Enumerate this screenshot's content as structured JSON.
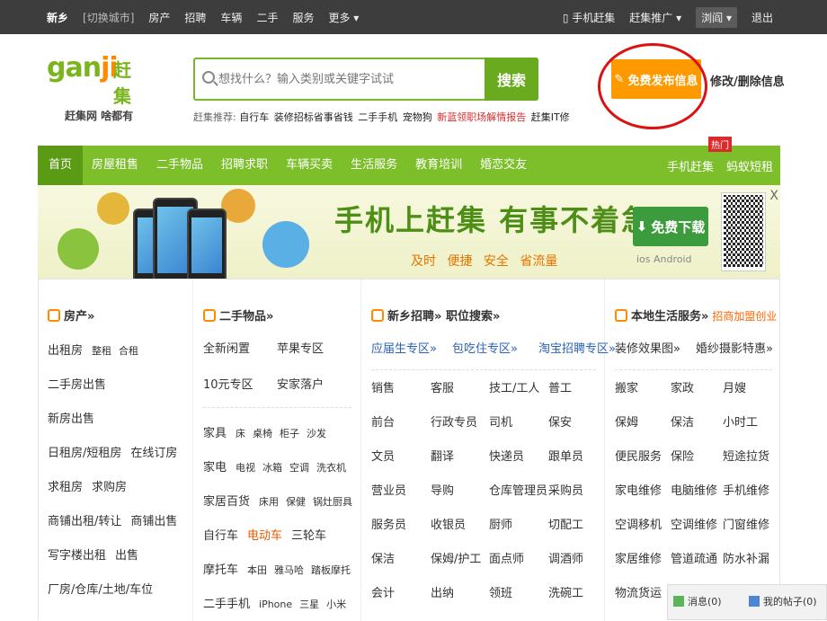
{
  "topbar": {
    "city": "新乡",
    "switch_city": "[切换城市]",
    "links": [
      "房产",
      "招聘",
      "车辆",
      "二手",
      "服务",
      "更多 ▾"
    ],
    "mobile": "手机赶集",
    "promote": "赶集推广 ▾",
    "user": "浏阎 ▾",
    "logout": "退出"
  },
  "logo": {
    "mark": "gan",
    "mark_accent": "ji",
    "cn": "赶集",
    "slogan": "赶集网 啥都有"
  },
  "search": {
    "placeholder": "想找什么？输入类别或关键字试试",
    "button": "搜索"
  },
  "hot": {
    "label": "赶集推荐:",
    "items": [
      "自行车",
      "装修招标省事省钱",
      "二手手机",
      "宠物狗",
      "新蓝领职场解情报告",
      "赶集IT修"
    ]
  },
  "post": {
    "button": "免费发布信息",
    "edit": "修改/删除信息"
  },
  "nav": {
    "items": [
      "首页",
      "房屋租售",
      "二手物品",
      "招聘求职",
      "车辆买卖",
      "生活服务",
      "教育培训",
      "婚恋交友"
    ],
    "right": [
      "手机赶集",
      "蚂蚁短租"
    ],
    "badge": "热门"
  },
  "banner": {
    "title": "手机上赶集  有事不着急",
    "sub": "及时 便捷 安全 省流量",
    "download": "免费下载",
    "os": "ios  Android",
    "close": "X"
  },
  "house": {
    "title": "房产»",
    "rows": [
      [
        "出租房",
        "整租",
        "合租"
      ],
      [
        "二手房出售"
      ],
      [
        "新房出售"
      ],
      [
        "日租房/短租房",
        "在线订房"
      ],
      [
        "求租房",
        "求购房"
      ],
      [
        "商铺出租/转让",
        "商铺出售"
      ],
      [
        "写字楼出租",
        "出售"
      ],
      [
        "厂房/仓库/土地/车位"
      ]
    ]
  },
  "used": {
    "title": "二手物品»",
    "top": [
      [
        "全新闲置",
        "苹果专区"
      ],
      [
        "10元专区",
        "安家落户"
      ]
    ],
    "rows": [
      [
        "家具",
        "床",
        "桌椅",
        "柜子",
        "沙发"
      ],
      [
        "家电",
        "电视",
        "冰箱",
        "空调",
        "洗衣机"
      ],
      [
        "家居百货",
        "床用",
        "保健",
        "锅灶厨具"
      ],
      [
        "自行车",
        "电动车",
        "三轮车"
      ],
      [
        "摩托车",
        "本田",
        "雅马哈",
        "踏板摩托"
      ],
      [
        "二手手机",
        "iPhone",
        "三星",
        "小米"
      ]
    ]
  },
  "jobs": {
    "title": "新乡招聘»",
    "search": "职位搜索»",
    "zones": [
      "应届生专区»",
      "包吃住专区»",
      "淘宝招聘专区»"
    ],
    "grid": [
      [
        "销售",
        "客服",
        "技工/工人",
        "普工"
      ],
      [
        "前台",
        "行政专员",
        "司机",
        "保安"
      ],
      [
        "文员",
        "翻译",
        "快递员",
        "跟单员"
      ],
      [
        "营业员",
        "导购",
        "仓库管理员",
        "采购员"
      ],
      [
        "服务员",
        "收银员",
        "厨师",
        "切配工"
      ],
      [
        "保洁",
        "保姆/护工",
        "面点师",
        "调酒师"
      ],
      [
        "会计",
        "出纳",
        "领班",
        "洗碗工"
      ]
    ]
  },
  "life": {
    "title": "本地生活服务»",
    "extra": "招商加盟创业",
    "links": [
      "装修效果图»",
      "婚纱摄影特惠»"
    ],
    "grid": [
      [
        "搬家",
        "家政",
        "月嫂"
      ],
      [
        "保姆",
        "保洁",
        "小时工"
      ],
      [
        "便民服务",
        "保险",
        "短途拉货"
      ],
      [
        "家电维修",
        "电脑维修",
        "手机维修"
      ],
      [
        "空调移机",
        "空调维修",
        "门窗维修"
      ],
      [
        "家居维修",
        "管道疏通",
        "防水补漏"
      ],
      [
        "物流货运"
      ]
    ]
  },
  "msgbar": {
    "messages": "消息(0)",
    "posts": "我的帖子(0)"
  }
}
